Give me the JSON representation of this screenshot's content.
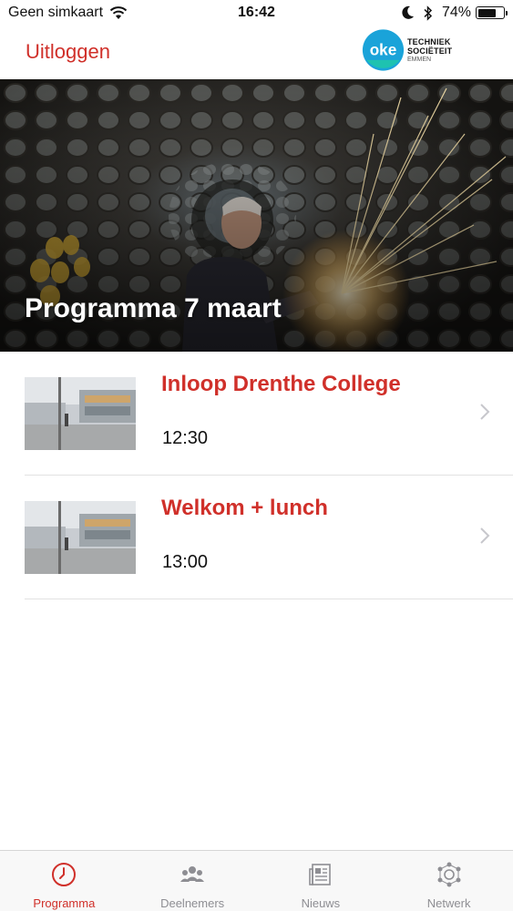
{
  "status_bar": {
    "carrier": "Geen simkaart",
    "time": "16:42",
    "battery_percent": "74%",
    "battery_level": 0.74
  },
  "nav": {
    "logout_label": "Uitloggen",
    "logo": {
      "mark": "oke",
      "name": "TECHNIEK SOCIËTEIT",
      "place": "EMMEN"
    }
  },
  "hero": {
    "title": "Programma 7 maart"
  },
  "program_items": [
    {
      "title": "Inloop Drenthe College",
      "time": "12:30"
    },
    {
      "title": "Welkom + lunch",
      "time": "13:00"
    }
  ],
  "tabs": [
    {
      "label": "Programma",
      "icon": "clock-icon",
      "active": true
    },
    {
      "label": "Deelnemers",
      "icon": "people-icon",
      "active": false
    },
    {
      "label": "Nieuws",
      "icon": "newspaper-icon",
      "active": false
    },
    {
      "label": "Netwerk",
      "icon": "network-icon",
      "active": false
    }
  ],
  "colors": {
    "accent": "#d0302a",
    "tab_inactive": "#8e8e93",
    "logo_blue": "#1aa3d9",
    "logo_teal": "#1ec2b0"
  }
}
